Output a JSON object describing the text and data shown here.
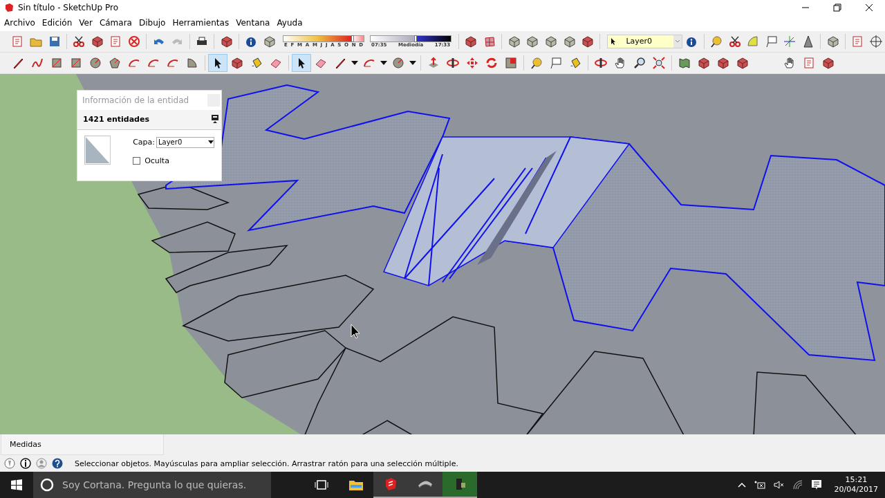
{
  "window": {
    "title": "Sin título - SketchUp Pro"
  },
  "menu": [
    "Archivo",
    "Edición",
    "Ver",
    "Cámara",
    "Dibujo",
    "Herramientas",
    "Ventana",
    "Ayuda"
  ],
  "shadow_settings": {
    "month_slider": {
      "level": 0.86
    },
    "time_slider": {
      "level": 0.56
    },
    "months": [
      "E",
      "F",
      "M",
      "A",
      "M",
      "J",
      "J",
      "A",
      "S",
      "O",
      "N",
      "D"
    ],
    "time_start": "07:35",
    "time_mid": "Mediodía",
    "time_end": "17:33"
  },
  "layer_dropdown": {
    "value": "Layer0"
  },
  "entity_info": {
    "title": "Información de la entidad",
    "count": "1421 entidades",
    "layer_label": "Capa:",
    "layer_value": "Layer0",
    "hidden_label": "Oculta",
    "hidden_checked": false
  },
  "measurements": {
    "label": "Medidas"
  },
  "status": {
    "hint": "Seleccionar objetos. Mayúsculas para ampliar selección. Arrastrar ratón para una selección múltiple."
  },
  "taskbar": {
    "search_placeholder": "Soy Cortana. Pregunta lo que quieras.",
    "time": "15:21",
    "date": "20/04/2017"
  }
}
